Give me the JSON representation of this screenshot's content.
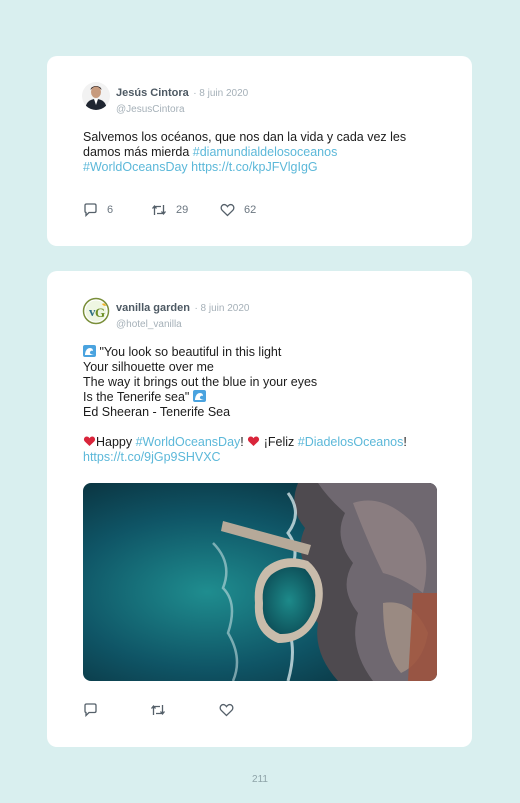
{
  "tweets": [
    {
      "author": "Jesús Cintora",
      "date": "· 8 juin 2020",
      "handle": "@JesusCintora",
      "text_plain_1": "Salvemos los océanos, que nos dan la vida y cada vez les",
      "text_plain_2": "damos más mierda ",
      "hashtag_1": "#diamundialdelosoceanos",
      "hashtag_2": "#WorldOceansDay",
      "url": "https://t.co/kpJFVlgIgG",
      "replies": "6",
      "retweets": "29",
      "likes": "62"
    },
    {
      "author": "vanilla garden",
      "date": "· 8 juin 2020",
      "handle": "@hotel_vanilla",
      "line_1": "\"You look so beautiful in this light",
      "line_2": "Your silhouette over me",
      "line_3": "The way it brings out the blue in your eyes",
      "line_4": "Is the Tenerife sea\"",
      "line_5": "Ed Sheeran - Tenerife Sea",
      "happy": "Happy ",
      "hashtag_1": "#WorldOceansDay",
      "bang_1": "!",
      "feliz": " ¡Feliz ",
      "hashtag_2": "#DiadelosOceanos",
      "bang_2": "!",
      "url": "https://t.co/9jGp9SHVXC",
      "image_alt": "aerial-view-rocky-coast-natural-pool"
    }
  ],
  "page_number": "211",
  "colors": {
    "background": "#d9efef",
    "link": "#5cb8d9",
    "card": "#ffffff"
  }
}
